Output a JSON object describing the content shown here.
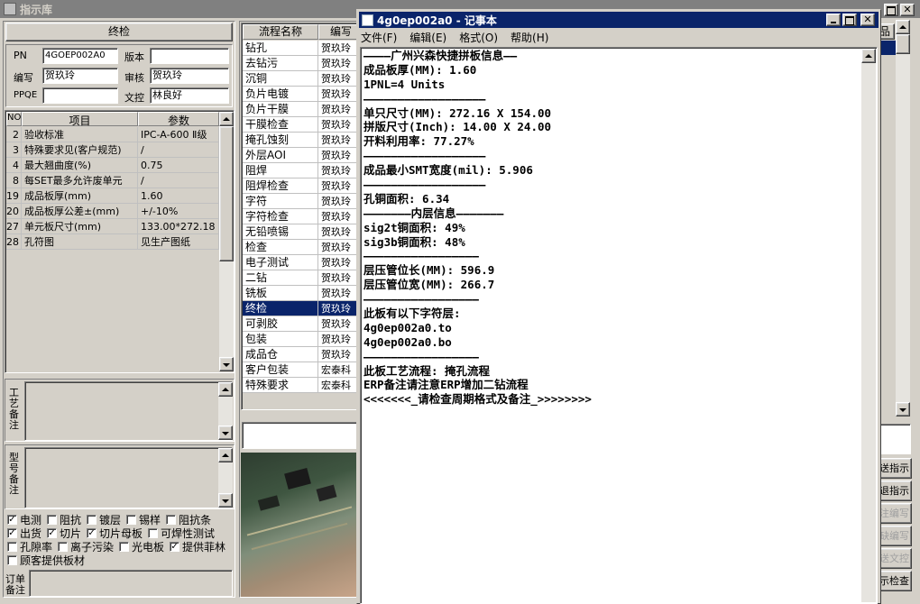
{
  "bg_window": {
    "title": "指示库"
  },
  "left": {
    "section_title": "终检",
    "fields": [
      {
        "label": "PN",
        "value": "4GOEP002A0"
      },
      {
        "label": "版本",
        "value": ""
      },
      {
        "label": "编写",
        "value": "贺玖玲"
      },
      {
        "label": "审核",
        "value": "贺玖玲"
      },
      {
        "label": "PPQE",
        "value": ""
      },
      {
        "label": "文控",
        "value": "林良好"
      }
    ],
    "table": {
      "headers": [
        "NO",
        "项目",
        "参数"
      ],
      "rows": [
        {
          "no": "2",
          "item": "验收标准",
          "param": "IPC-A-600 Ⅱ级"
        },
        {
          "no": "3",
          "item": "特殊要求见(客户规范)",
          "param": "/"
        },
        {
          "no": "4",
          "item": "最大翘曲度(%)",
          "param": "0.75"
        },
        {
          "no": "8",
          "item": "每SET最多允许废单元",
          "param": "/"
        },
        {
          "no": "19",
          "item": "成品板厚(mm)",
          "param": "1.60"
        },
        {
          "no": "20",
          "item": "成品板厚公差±(mm)",
          "param": "+/-10%"
        },
        {
          "no": "27",
          "item": "单元板尺寸(mm)",
          "param": "133.00*272.18"
        },
        {
          "no": "28",
          "item": "孔符图",
          "param": "见生产图纸"
        }
      ]
    },
    "notes": [
      {
        "label": "工艺备注",
        "value": ""
      },
      {
        "label": "型号备注",
        "value": ""
      }
    ],
    "checkboxes": [
      [
        {
          "label": "电测",
          "checked": true
        },
        {
          "label": "阻抗",
          "checked": false
        },
        {
          "label": "镀层",
          "checked": false
        },
        {
          "label": "锡样",
          "checked": false
        },
        {
          "label": "阻抗条",
          "checked": false
        }
      ],
      [
        {
          "label": "出货",
          "checked": true
        },
        {
          "label": "切片",
          "checked": true
        },
        {
          "label": "切片母板",
          "checked": true
        },
        {
          "label": "可焊性测试",
          "checked": false
        }
      ],
      [
        {
          "label": "孔隙率",
          "checked": false
        },
        {
          "label": "离子污染",
          "checked": false
        },
        {
          "label": "光电板",
          "checked": false
        },
        {
          "label": "提供菲林",
          "checked": true
        }
      ],
      [
        {
          "label": "顾客提供板材",
          "checked": false
        }
      ]
    ],
    "order_label": "订单备注"
  },
  "middle": {
    "headers": [
      "流程名称",
      "编写"
    ],
    "selected_index": 17,
    "rows": [
      {
        "name": "钻孔",
        "author": "贺玖玲"
      },
      {
        "name": "去钻污",
        "author": "贺玖玲"
      },
      {
        "name": "沉铜",
        "author": "贺玖玲"
      },
      {
        "name": "负片电镀",
        "author": "贺玖玲"
      },
      {
        "name": "负片干膜",
        "author": "贺玖玲"
      },
      {
        "name": "干膜检查",
        "author": "贺玖玲"
      },
      {
        "name": "掩孔蚀刻",
        "author": "贺玖玲"
      },
      {
        "name": "外层AOI",
        "author": "贺玖玲"
      },
      {
        "name": "阻焊",
        "author": "贺玖玲"
      },
      {
        "name": "阻焊检查",
        "author": "贺玖玲"
      },
      {
        "name": "字符",
        "author": "贺玖玲"
      },
      {
        "name": "字符检查",
        "author": "贺玖玲"
      },
      {
        "name": "无铅喷锡",
        "author": "贺玖玲"
      },
      {
        "name": "检查",
        "author": "贺玖玲"
      },
      {
        "name": "电子测试",
        "author": "贺玖玲"
      },
      {
        "name": "二钻",
        "author": "贺玖玲"
      },
      {
        "name": "铣板",
        "author": "贺玖玲"
      },
      {
        "name": "终检",
        "author": "贺玖玲"
      },
      {
        "name": "可剥胶",
        "author": "贺玖玲"
      },
      {
        "name": "包装",
        "author": "贺玖玲"
      },
      {
        "name": "成品仓",
        "author": "贺玖玲"
      },
      {
        "name": "客户包装",
        "author": "宏泰科"
      },
      {
        "name": "特殊要求",
        "author": "宏泰科"
      }
    ]
  },
  "right_buttons": [
    {
      "label": "品"
    },
    {
      "label": "送指示"
    },
    {
      "label": "退指示"
    },
    {
      "label": "注编写"
    },
    {
      "label": "缺编写"
    },
    {
      "label": "送文控"
    },
    {
      "label": "示检查"
    }
  ],
  "notepad": {
    "title": "4g0ep002a0 - 记事本",
    "menu": [
      "文件(F)",
      "编辑(E)",
      "格式(O)",
      "帮助(H)"
    ],
    "lines": [
      "————广州兴森快捷拼板信息——",
      "成品板厚(MM): 1.60",
      "1PNL=4 Units",
      "——————————————————",
      "单只尺寸(MM): 272.16 X 154.00",
      "拼版尺寸(Inch): 14.00 X 24.00",
      "开料利用率: 77.27%",
      "——————————————————",
      "成品最小SMT宽度(mil): 5.906",
      "——————————————————",
      "孔铜面积: 6.34",
      "———————内层信息———————",
      "sig2t铜面积: 49%",
      "sig3b铜面积: 48%",
      "—————————————————",
      "层压管位长(MM): 596.9",
      "层压管位宽(MM): 266.7",
      "—————————————————",
      "此板有以下字符层:",
      "4g0ep002a0.to",
      "4g0ep002a0.bo",
      "—————————————————",
      "此板工艺流程: 掩孔流程",
      "ERP备注请注意ERP增加二钻流程",
      "<<<<<<<_请检查周期格式及备注_>>>>>>>>"
    ]
  }
}
